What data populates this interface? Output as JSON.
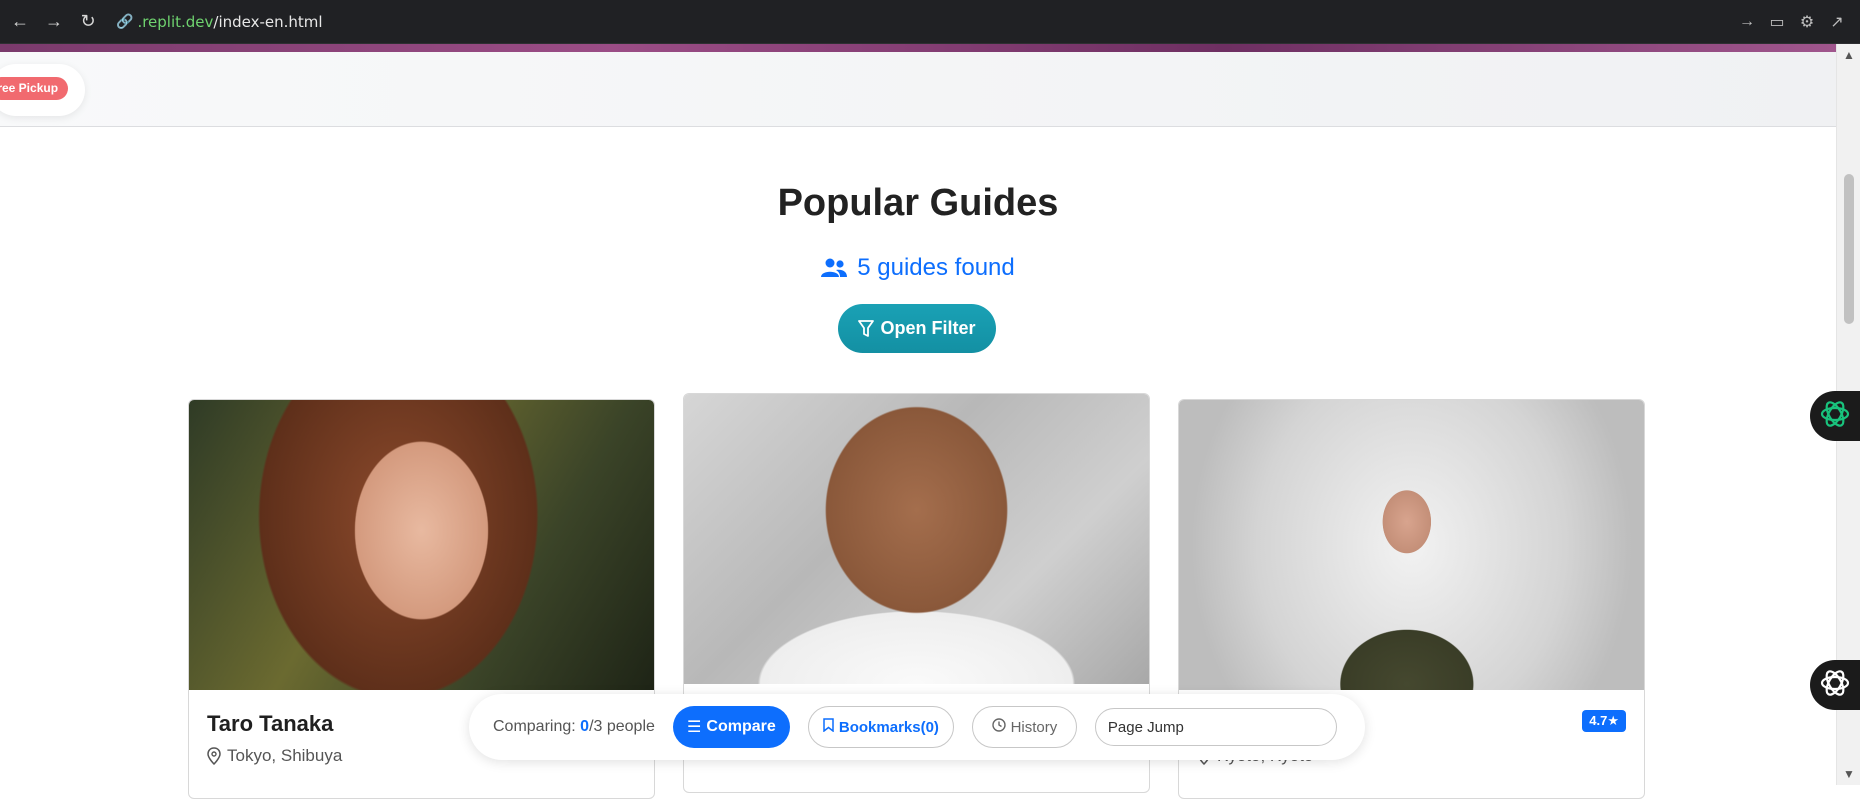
{
  "browser": {
    "url_domain": ".replit.dev",
    "url_path": "/index-en.html"
  },
  "top": {
    "pickup_badge": "Free Pickup"
  },
  "section": {
    "title": "Popular Guides",
    "guides_found": "5 guides found",
    "filter_button": "Open Filter"
  },
  "cards": [
    {
      "name": "Taro Tanaka",
      "location": "Tokyo, Shibuya",
      "rating": ""
    },
    {
      "name": "",
      "location": "",
      "rating": ""
    },
    {
      "name": "",
      "location": "Kyoto, Kyoto",
      "rating": "4.7★"
    }
  ],
  "compare_bar": {
    "label": "Comparing:",
    "count": "0",
    "suffix": "/3 people",
    "compare_button": "Compare",
    "bookmarks_button": "Bookmarks(0)",
    "history_button": "History",
    "page_jump_placeholder": "Page Jump"
  },
  "colors": {
    "primary": "#0d6efd",
    "teal": "#1aa1b5",
    "badge_red": "#f16a6f"
  }
}
